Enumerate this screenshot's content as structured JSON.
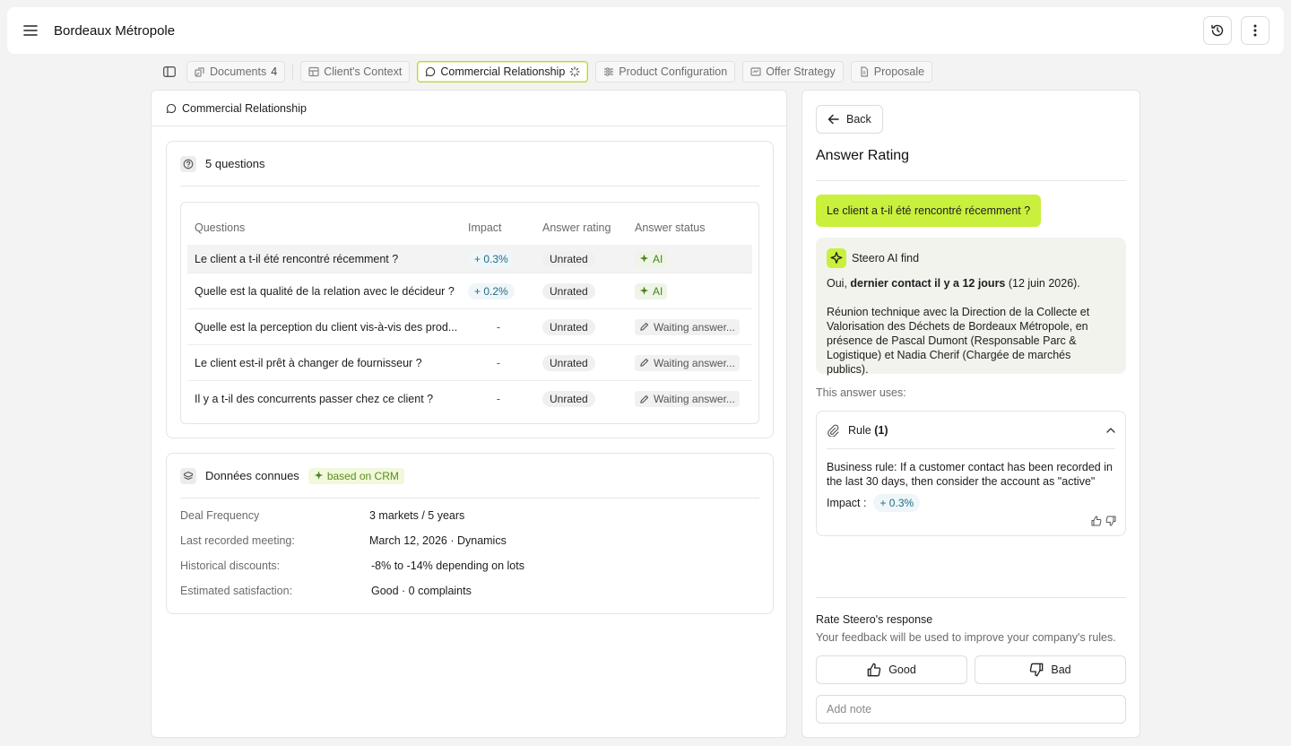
{
  "header": {
    "title": "Bordeaux Métropole"
  },
  "tabs": [
    {
      "label": "Documents",
      "count": "4"
    },
    {
      "label": "Client's Context"
    },
    {
      "label": "Commercial Relationship"
    },
    {
      "label": "Product Configuration"
    },
    {
      "label": "Offer Strategy"
    },
    {
      "label": "Proposale"
    }
  ],
  "main": {
    "panel_title": "Commercial Relationship",
    "questions_card": {
      "title": "5 questions",
      "columns": [
        "Questions",
        "Impact",
        "Answer rating",
        "Answer status"
      ],
      "rows": [
        {
          "question": "Le client a t-il été rencontré récemment ?",
          "impact": "+ 0.3%",
          "rating": "Unrated",
          "status": "AI"
        },
        {
          "question": "Quelle est la qualité de la relation avec le décideur ?",
          "impact": "+ 0.2%",
          "rating": "Unrated",
          "status": "AI"
        },
        {
          "question": "Quelle est la perception du client vis-à-vis des prod...",
          "impact": "-",
          "rating": "Unrated",
          "status": "Waiting answer..."
        },
        {
          "question": "Le client est-il prêt à changer de fournisseur ?",
          "impact": "-",
          "rating": "Unrated",
          "status": "Waiting answer..."
        },
        {
          "question": "Il y a t-il des concurrents passer chez ce client ?",
          "impact": "-",
          "rating": "Unrated",
          "status": "Waiting answer..."
        }
      ]
    },
    "data_card": {
      "title": "Données connues",
      "badge": "based on CRM",
      "items": [
        {
          "key": "Deal Frequency",
          "value": "3 markets / 5 years"
        },
        {
          "key": "Last recorded meeting:",
          "value": "March 12, 2026 · Dynamics"
        },
        {
          "key": "Historical discounts:",
          "value": "-8% to -14% depending on lots"
        },
        {
          "key": "Estimated satisfaction:",
          "value": "Good · 0 complaints"
        }
      ]
    }
  },
  "side": {
    "back_label": "Back",
    "title": "Answer Rating",
    "question": "Le client a t-il été rencontré récemment ?",
    "ai_title": "Steero AI find",
    "ai_line_pre": "Oui, ",
    "ai_line_bold": "dernier contact il y a 12 jours",
    "ai_line_post": " (12 juin 2026).",
    "ai_paragraph": "Réunion technique avec la Direction de la Collecte et Valorisation des Déchets de Bordeaux Métropole, en présence de Pascal Dumont (Responsable Parc & Logistique) et Nadia Cherif (Chargée de marchés publics).",
    "uses_label": "This answer uses:",
    "rule": {
      "title": "Rule",
      "count": "(1)",
      "text": "Business rule: If a customer contact has been recorded in the last 30 days, then consider the account as \"active\"",
      "impact_label": "Impact :",
      "impact_value": "+ 0.3%"
    },
    "rate_title": "Rate Steero's response",
    "rate_sub": "Your feedback will be used to improve your company's rules.",
    "good_label": "Good",
    "bad_label": "Bad",
    "note_placeholder": "Add note"
  },
  "colors": {
    "accent": "#c8f03c",
    "ai_green": "#4b8221",
    "impact_blue": "#246d82"
  },
  "icons": [
    "menu-icon",
    "history-icon",
    "more-vertical-icon",
    "sidebar-icon",
    "documents-icon",
    "context-icon",
    "chat-icon",
    "loading-icon",
    "config-icon",
    "strategy-icon",
    "file-icon",
    "question-icon",
    "sparkle-icon",
    "pencil-icon",
    "database-icon",
    "arrow-left-icon",
    "paperclip-icon",
    "chevron-up-icon",
    "thumbs-up-icon",
    "thumbs-down-icon"
  ]
}
